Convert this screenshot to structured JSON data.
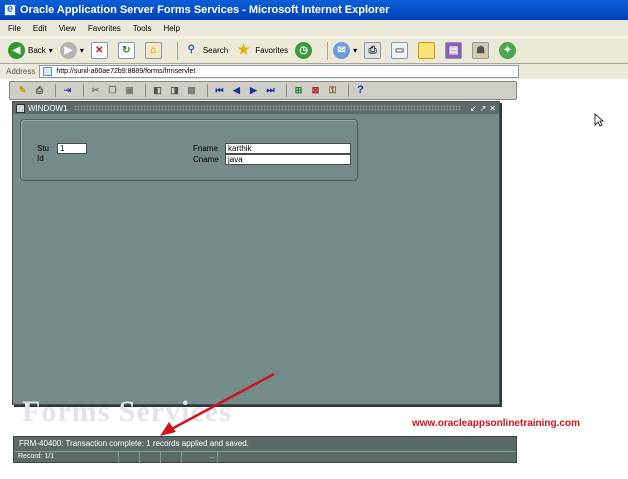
{
  "window": {
    "title": "Oracle Application Server Forms Services - Microsoft Internet Explorer"
  },
  "menu": [
    "File",
    "Edit",
    "View",
    "Favorites",
    "Tools",
    "Help"
  ],
  "toolbar": {
    "back_label": "Back",
    "search_label": "Search",
    "favorites_label": "Favorites"
  },
  "address": {
    "label": "Address",
    "value": "http://sunil-a60ae72b9:8889/forms/frmservlet"
  },
  "form_window": {
    "title": "WINDOW1",
    "fields": {
      "stu_id_label_1": "Stu",
      "stu_id_label_2": "Id",
      "stu_id_value": "1",
      "fname_label": "Fname",
      "fname_value": "karthik",
      "cname_label": "Cname",
      "cname_value": "java"
    }
  },
  "watermark_text": "Forms Services",
  "website": "www.oracleappsonlinetraining.com",
  "status": {
    "message": "FRM-40400: Transaction complete: 1 records applied and saved.",
    "record": "Record: 1/1",
    "ellipsis": "..."
  },
  "colors": {
    "form_bg": "#738b89",
    "title_blue": "#0a5fd8",
    "annotation_red": "#d0141c"
  }
}
